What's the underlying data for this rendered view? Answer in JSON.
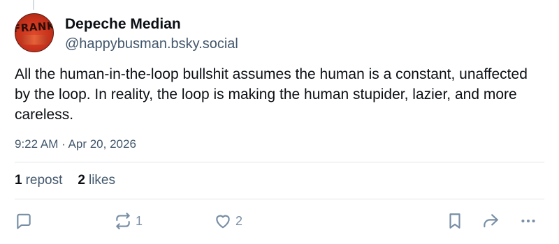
{
  "post": {
    "author": {
      "display_name": "Depeche Median",
      "handle": "@happybusman.bsky.social",
      "avatar_text": "FRANK"
    },
    "text": "All the human-in-the-loop bullshit assumes the human is a constant, unaffected by the loop. In reality, the loop is making the human stupider, lazier, and more careless.",
    "timestamp": "9:22 AM · Apr 20, 2026",
    "stats": {
      "reposts_count": "1",
      "reposts_label": "repost",
      "likes_count": "2",
      "likes_label": "likes"
    },
    "actions": {
      "reply_icon": "reply-icon",
      "repost_icon": "repost-icon",
      "repost_count": "1",
      "like_icon": "heart-icon",
      "like_count": "2",
      "bookmark_icon": "bookmark-icon",
      "share_icon": "share-icon",
      "more_icon": "more-options-icon"
    }
  },
  "colors": {
    "text_primary": "#0b0f14",
    "text_secondary": "#42576c",
    "icon": "#788ea5",
    "divider": "#dfe4ea"
  }
}
